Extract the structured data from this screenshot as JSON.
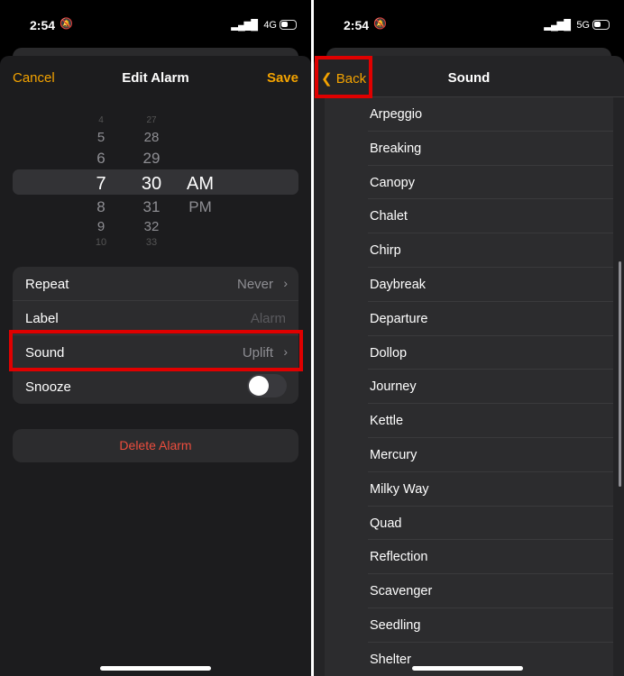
{
  "left": {
    "status": {
      "time": "2:54",
      "network": "4G"
    },
    "nav": {
      "cancel": "Cancel",
      "title": "Edit Alarm",
      "save": "Save"
    },
    "picker": {
      "hours": [
        "4",
        "5",
        "6",
        "7",
        "8",
        "9",
        "10"
      ],
      "minutes": [
        "27",
        "28",
        "29",
        "30",
        "31",
        "32",
        "33"
      ],
      "periods": [
        "AM",
        "PM"
      ],
      "selected": {
        "hour": "7",
        "minute": "30",
        "period": "AM"
      }
    },
    "settings": [
      {
        "label": "Repeat",
        "value": "Never"
      },
      {
        "label": "Label",
        "value": "Alarm"
      },
      {
        "label": "Sound",
        "value": "Uplift"
      },
      {
        "label": "Snooze",
        "toggle": false
      }
    ],
    "delete": "Delete Alarm"
  },
  "right": {
    "status": {
      "time": "2:54",
      "network": "5G"
    },
    "nav": {
      "back": "Back",
      "title": "Sound"
    },
    "sounds": [
      "Arpeggio",
      "Breaking",
      "Canopy",
      "Chalet",
      "Chirp",
      "Daybreak",
      "Departure",
      "Dollop",
      "Journey",
      "Kettle",
      "Mercury",
      "Milky Way",
      "Quad",
      "Reflection",
      "Scavenger",
      "Seedling",
      "Shelter"
    ]
  },
  "highlight_color": "#e00000",
  "accent": "#f4a300"
}
